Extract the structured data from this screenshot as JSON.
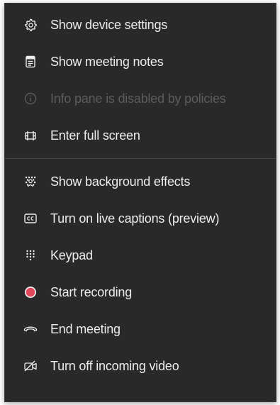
{
  "menu": {
    "items": [
      {
        "label": "Show device settings",
        "icon": "gear-icon",
        "enabled": true
      },
      {
        "label": "Show meeting notes",
        "icon": "notes-icon",
        "enabled": true
      },
      {
        "label": "Info pane is disabled by policies",
        "icon": "info-icon",
        "enabled": false
      },
      {
        "label": "Enter full screen",
        "icon": "fullscreen-icon",
        "enabled": true
      },
      {
        "label": "Show background effects",
        "icon": "background-effects-icon",
        "enabled": true
      },
      {
        "label": "Turn on live captions (preview)",
        "icon": "captions-icon",
        "enabled": true
      },
      {
        "label": "Keypad",
        "icon": "keypad-icon",
        "enabled": true
      },
      {
        "label": "Start recording",
        "icon": "record-icon",
        "enabled": true
      },
      {
        "label": "End meeting",
        "icon": "end-call-icon",
        "enabled": true
      },
      {
        "label": "Turn off incoming video",
        "icon": "video-off-icon",
        "enabled": true
      }
    ]
  },
  "colors": {
    "background": "#292929",
    "text": "#ececec",
    "disabled_text": "#5c5c5c",
    "record_red": "#e3475a",
    "divider": "#444444"
  }
}
